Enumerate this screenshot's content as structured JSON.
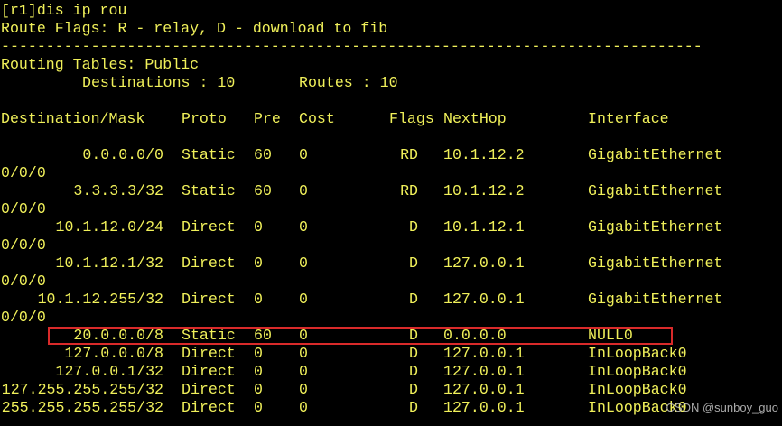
{
  "command_line": "[r1]dis ip rou",
  "flags_legend": "Route Flags: R - relay, D - download to fib",
  "separator": "------------------------------------------------------------------------------",
  "table_title": "Routing Tables: Public",
  "summary": {
    "destinations_label": "Destinations : 10",
    "routes_label": "Routes : 10"
  },
  "headers": {
    "dest": "Destination/Mask",
    "proto": "Proto",
    "pre": "Pre",
    "cost": "Cost",
    "flags": "Flags",
    "nexthop": "NextHop",
    "iface": "Interface"
  },
  "routes": [
    {
      "dest": "0.0.0.0/0",
      "proto": "Static",
      "pre": "60",
      "cost": "0",
      "flags": "RD",
      "nexthop": "10.1.12.2",
      "iface": "GigabitEthernet",
      "iface_cont": "0/0/0"
    },
    {
      "dest": "3.3.3.3/32",
      "proto": "Static",
      "pre": "60",
      "cost": "0",
      "flags": "RD",
      "nexthop": "10.1.12.2",
      "iface": "GigabitEthernet",
      "iface_cont": "0/0/0"
    },
    {
      "dest": "10.1.12.0/24",
      "proto": "Direct",
      "pre": "0",
      "cost": "0",
      "flags": "D",
      "nexthop": "10.1.12.1",
      "iface": "GigabitEthernet",
      "iface_cont": "0/0/0"
    },
    {
      "dest": "10.1.12.1/32",
      "proto": "Direct",
      "pre": "0",
      "cost": "0",
      "flags": "D",
      "nexthop": "127.0.0.1",
      "iface": "GigabitEthernet",
      "iface_cont": "0/0/0"
    },
    {
      "dest": "10.1.12.255/32",
      "proto": "Direct",
      "pre": "0",
      "cost": "0",
      "flags": "D",
      "nexthop": "127.0.0.1",
      "iface": "GigabitEthernet",
      "iface_cont": "0/0/0"
    },
    {
      "dest": "20.0.0.0/8",
      "proto": "Static",
      "pre": "60",
      "cost": "0",
      "flags": "D",
      "nexthop": "0.0.0.0",
      "iface": "NULL0",
      "iface_cont": ""
    },
    {
      "dest": "127.0.0.0/8",
      "proto": "Direct",
      "pre": "0",
      "cost": "0",
      "flags": "D",
      "nexthop": "127.0.0.1",
      "iface": "InLoopBack0",
      "iface_cont": ""
    },
    {
      "dest": "127.0.0.1/32",
      "proto": "Direct",
      "pre": "0",
      "cost": "0",
      "flags": "D",
      "nexthop": "127.0.0.1",
      "iface": "InLoopBack0",
      "iface_cont": ""
    },
    {
      "dest": "127.255.255.255/32",
      "proto": "Direct",
      "pre": "0",
      "cost": "0",
      "flags": "D",
      "nexthop": "127.0.0.1",
      "iface": "InLoopBack0",
      "iface_cont": ""
    },
    {
      "dest": "255.255.255.255/32",
      "proto": "Direct",
      "pre": "0",
      "cost": "0",
      "flags": "D",
      "nexthop": "127.0.0.1",
      "iface": "InLoopBack0",
      "iface_cont": ""
    }
  ],
  "watermark": "CSDN @sunboy_guo",
  "colors": {
    "background": "#000000",
    "text": "#f0f05a",
    "highlight_border": "#d92a2a"
  }
}
